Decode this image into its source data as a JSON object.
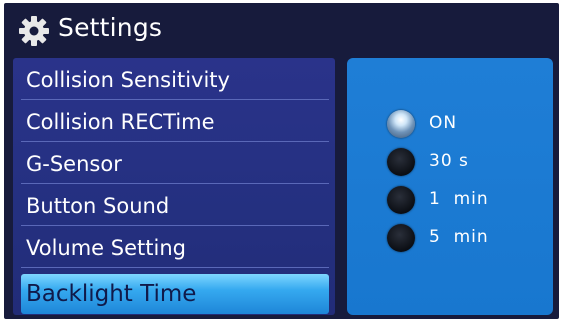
{
  "header": {
    "title": "Settings",
    "icon": "gear-icon"
  },
  "menu": {
    "items": [
      {
        "label": "Collision Sensitivity",
        "selected": false
      },
      {
        "label": "Collision RECTime",
        "selected": false
      },
      {
        "label": "G-Sensor",
        "selected": false
      },
      {
        "label": "Button Sound",
        "selected": false
      },
      {
        "label": "Volume Setting",
        "selected": false
      },
      {
        "label": "Backlight Time",
        "selected": true
      }
    ]
  },
  "options": {
    "items": [
      {
        "label": "ON",
        "checked": true
      },
      {
        "label": "30 s",
        "checked": false
      },
      {
        "label": "1  min",
        "checked": false
      },
      {
        "label": "5  min",
        "checked": false
      }
    ]
  },
  "colors": {
    "background": "#171b3c",
    "menu_panel": "#2a338a",
    "selected_item": "#35a9f0",
    "options_panel": "#1f7ed6"
  }
}
